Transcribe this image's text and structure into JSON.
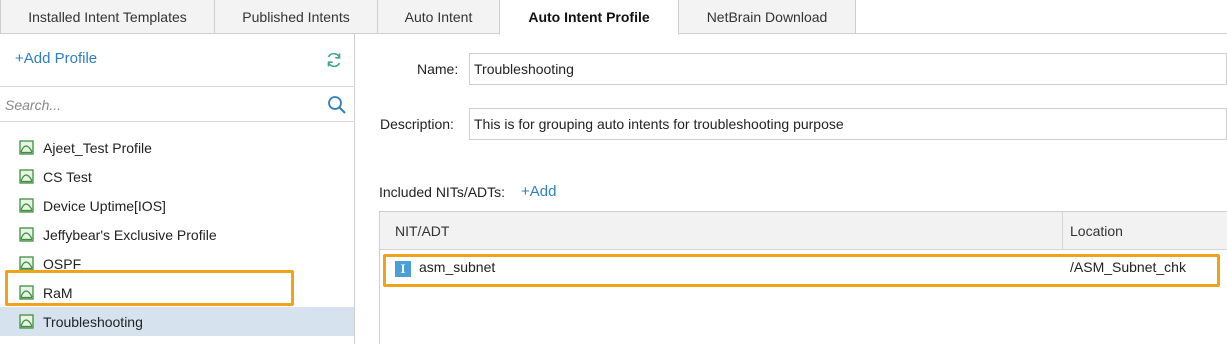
{
  "tabs": [
    {
      "label": "Installed Intent Templates",
      "active": false
    },
    {
      "label": "Published Intents",
      "active": false
    },
    {
      "label": "Auto Intent",
      "active": false
    },
    {
      "label": "Auto Intent Profile",
      "active": true
    },
    {
      "label": "NetBrain Download",
      "active": false
    }
  ],
  "sidebar": {
    "add_profile_label": "+Add Profile",
    "refresh_icon": "refresh-icon",
    "search": {
      "placeholder": "Search...",
      "value": "",
      "icon": "search-icon"
    },
    "profiles": [
      {
        "label": "Ajeet_Test Profile",
        "icon": "profile-icon",
        "selected": false
      },
      {
        "label": "CS Test",
        "icon": "profile-icon",
        "selected": false
      },
      {
        "label": "Device Uptime[IOS]",
        "icon": "profile-icon",
        "selected": false
      },
      {
        "label": "Jeffybear's Exclusive Profile",
        "icon": "profile-icon",
        "selected": false
      },
      {
        "label": "OSPF",
        "icon": "profile-icon",
        "selected": false
      },
      {
        "label": "RaM",
        "icon": "profile-icon",
        "selected": false
      },
      {
        "label": "Troubleshooting",
        "icon": "profile-icon",
        "selected": true
      }
    ]
  },
  "detail": {
    "name_label": "Name:",
    "name_value": "Troubleshooting",
    "description_label": "Description:",
    "description_value": "This is for grouping auto intents for troubleshooting purpose",
    "included_label": "Included NITs/ADTs:",
    "add_label": "+Add",
    "grid": {
      "columns": [
        "NIT/ADT",
        "Location"
      ],
      "rows": [
        {
          "icon": "intent-template-icon",
          "icon_glyph": "I",
          "name": "asm_subnet",
          "location": "/ASM_Subnet_chk"
        }
      ]
    }
  },
  "colors": {
    "accent": "#2f7fc1",
    "highlight": "#f0a21b",
    "selected_row": "#d6e3ee",
    "profile_icon": "#3f8f3f"
  }
}
